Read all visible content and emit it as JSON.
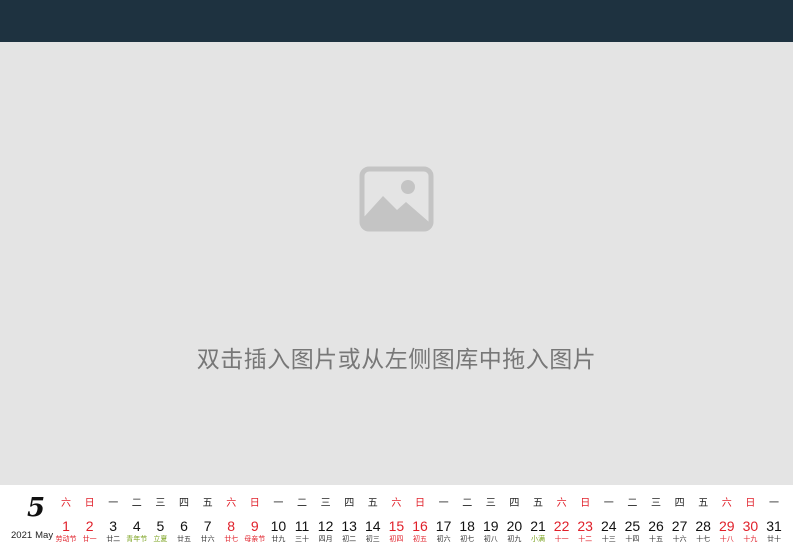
{
  "placeholder": {
    "icon": "image-icon",
    "text": "双击插入图片或从左侧图库中拖入图片"
  },
  "calendar": {
    "month_number": "5",
    "year": "2021",
    "month_name": "May",
    "colors": {
      "weekend": "#e0202a",
      "festival": "#e0202a",
      "solar_term": "#7aa21e",
      "normal": "#111111"
    },
    "days": [
      {
        "weekday": "六",
        "date": "1",
        "lunar": "劳动节",
        "weekend": true,
        "kind": "festival"
      },
      {
        "weekday": "日",
        "date": "2",
        "lunar": "廿一",
        "weekend": true,
        "kind": "normal"
      },
      {
        "weekday": "一",
        "date": "3",
        "lunar": "廿二",
        "weekend": false,
        "kind": "normal"
      },
      {
        "weekday": "二",
        "date": "4",
        "lunar": "青年节",
        "weekend": false,
        "kind": "solar-term"
      },
      {
        "weekday": "三",
        "date": "5",
        "lunar": "立夏",
        "weekend": false,
        "kind": "solar-term"
      },
      {
        "weekday": "四",
        "date": "6",
        "lunar": "廿五",
        "weekend": false,
        "kind": "normal"
      },
      {
        "weekday": "五",
        "date": "7",
        "lunar": "廿六",
        "weekend": false,
        "kind": "normal"
      },
      {
        "weekday": "六",
        "date": "8",
        "lunar": "廿七",
        "weekend": true,
        "kind": "normal"
      },
      {
        "weekday": "日",
        "date": "9",
        "lunar": "母亲节",
        "weekend": true,
        "kind": "festival"
      },
      {
        "weekday": "一",
        "date": "10",
        "lunar": "廿九",
        "weekend": false,
        "kind": "normal"
      },
      {
        "weekday": "二",
        "date": "11",
        "lunar": "三十",
        "weekend": false,
        "kind": "normal"
      },
      {
        "weekday": "三",
        "date": "12",
        "lunar": "四月",
        "weekend": false,
        "kind": "normal"
      },
      {
        "weekday": "四",
        "date": "13",
        "lunar": "初二",
        "weekend": false,
        "kind": "normal"
      },
      {
        "weekday": "五",
        "date": "14",
        "lunar": "初三",
        "weekend": false,
        "kind": "normal"
      },
      {
        "weekday": "六",
        "date": "15",
        "lunar": "初四",
        "weekend": true,
        "kind": "normal"
      },
      {
        "weekday": "日",
        "date": "16",
        "lunar": "初五",
        "weekend": true,
        "kind": "normal"
      },
      {
        "weekday": "一",
        "date": "17",
        "lunar": "初六",
        "weekend": false,
        "kind": "normal"
      },
      {
        "weekday": "二",
        "date": "18",
        "lunar": "初七",
        "weekend": false,
        "kind": "normal"
      },
      {
        "weekday": "三",
        "date": "19",
        "lunar": "初八",
        "weekend": false,
        "kind": "normal"
      },
      {
        "weekday": "四",
        "date": "20",
        "lunar": "初九",
        "weekend": false,
        "kind": "normal"
      },
      {
        "weekday": "五",
        "date": "21",
        "lunar": "小满",
        "weekend": false,
        "kind": "solar-term"
      },
      {
        "weekday": "六",
        "date": "22",
        "lunar": "十一",
        "weekend": true,
        "kind": "normal"
      },
      {
        "weekday": "日",
        "date": "23",
        "lunar": "十二",
        "weekend": true,
        "kind": "normal"
      },
      {
        "weekday": "一",
        "date": "24",
        "lunar": "十三",
        "weekend": false,
        "kind": "normal"
      },
      {
        "weekday": "二",
        "date": "25",
        "lunar": "十四",
        "weekend": false,
        "kind": "normal"
      },
      {
        "weekday": "三",
        "date": "26",
        "lunar": "十五",
        "weekend": false,
        "kind": "normal"
      },
      {
        "weekday": "四",
        "date": "27",
        "lunar": "十六",
        "weekend": false,
        "kind": "normal"
      },
      {
        "weekday": "五",
        "date": "28",
        "lunar": "十七",
        "weekend": false,
        "kind": "normal"
      },
      {
        "weekday": "六",
        "date": "29",
        "lunar": "十八",
        "weekend": true,
        "kind": "normal"
      },
      {
        "weekday": "日",
        "date": "30",
        "lunar": "十九",
        "weekend": true,
        "kind": "normal"
      },
      {
        "weekday": "一",
        "date": "31",
        "lunar": "廿十",
        "weekend": false,
        "kind": "normal"
      }
    ]
  }
}
